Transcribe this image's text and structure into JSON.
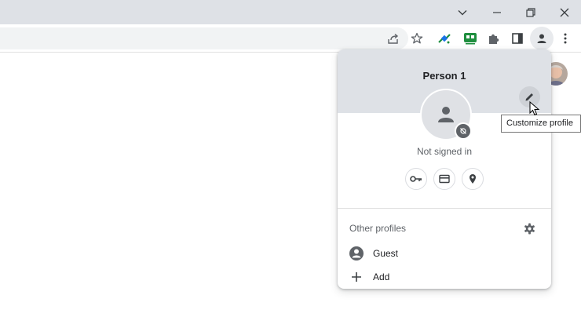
{
  "window": {
    "tab_search_icon": "chevron-down-icon",
    "minimize_icon": "minimize-icon",
    "restore_icon": "restore-icon",
    "close_icon": "close-icon"
  },
  "toolbar": {
    "icons": [
      "share-icon",
      "star-icon",
      "satellite-extension-icon",
      "green-extension-icon",
      "puzzle-extensions-icon",
      "side-panel-icon",
      "profile-icon",
      "more-icon"
    ]
  },
  "profile_menu": {
    "name": "Person 1",
    "status": "Not signed in",
    "quick_icons": [
      "key-icon",
      "credit-card-icon",
      "location-pin-icon"
    ],
    "other_profiles_title": "Other profiles",
    "profiles": [
      {
        "label": "Guest",
        "icon": "guest-account-icon"
      },
      {
        "label": "Add",
        "icon": "plus-icon"
      }
    ]
  },
  "tooltip": {
    "text": "Customize profile"
  },
  "colors": {
    "titlebar": "#dee1e6",
    "menu_band": "#dee1e6",
    "icon_gray": "#5f6368",
    "extension_green": "#1e8e3e",
    "extension_blue": "#1a73e8"
  }
}
